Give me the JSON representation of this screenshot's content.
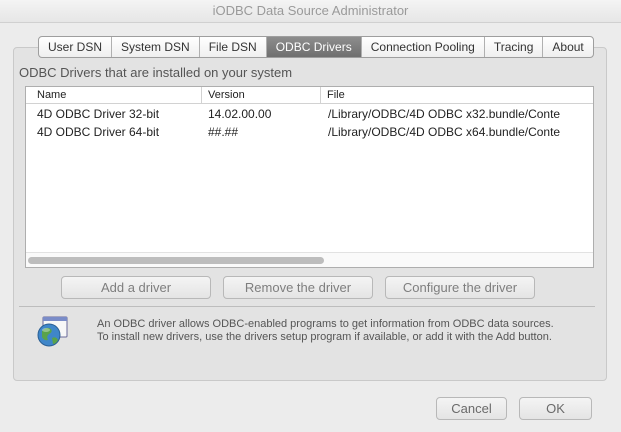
{
  "window": {
    "title": "iODBC Data Source Administrator"
  },
  "tabs": [
    {
      "label": "User DSN"
    },
    {
      "label": "System DSN"
    },
    {
      "label": "File DSN"
    },
    {
      "label": "ODBC Drivers",
      "active": true
    },
    {
      "label": "Connection Pooling"
    },
    {
      "label": "Tracing"
    },
    {
      "label": "About"
    }
  ],
  "main": {
    "heading": "ODBC Drivers that are installed on your system",
    "table": {
      "columns": [
        "Name",
        "Version",
        "File"
      ],
      "rows": [
        {
          "name": "4D ODBC Driver 32-bit",
          "version": "14.02.00.00",
          "file": "/Library/ODBC/4D ODBC x32.bundle/Conte"
        },
        {
          "name": "4D ODBC Driver 64-bit",
          "version": "##.##",
          "file": "/Library/ODBC/4D ODBC x64.bundle/Conte"
        }
      ]
    },
    "buttons": {
      "add": "Add a driver",
      "remove": "Remove the driver",
      "configure": "Configure the driver"
    },
    "info_text": "An ODBC driver allows ODBC-enabled programs to get information from ODBC data sources. To install new drivers, use the drivers setup program if available, or add it with the Add button."
  },
  "footer": {
    "cancel": "Cancel",
    "ok": "OK"
  },
  "icons": {
    "info": "globe-window-icon"
  }
}
